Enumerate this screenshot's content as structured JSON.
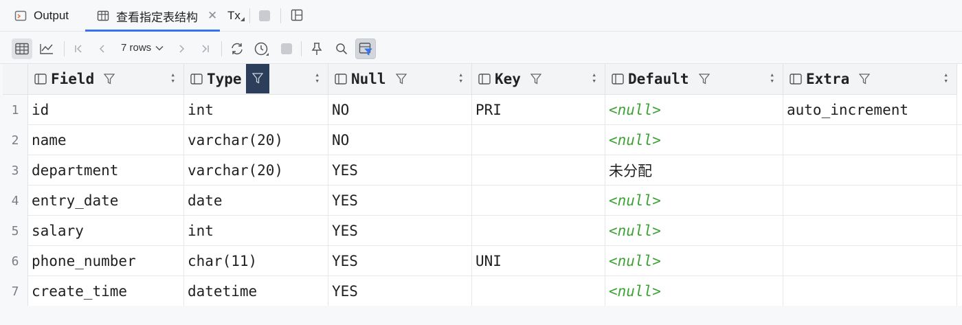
{
  "tabs": [
    {
      "label": "Output",
      "icon": "output-console-icon"
    },
    {
      "label": "查看指定表结构",
      "icon": "table-icon",
      "active": true
    },
    {
      "label": "Tx",
      "icon": "transaction-mode-icon"
    }
  ],
  "toolbar": {
    "rows_label": "7 rows"
  },
  "columns": [
    {
      "label": "Field"
    },
    {
      "label": "Type"
    },
    {
      "label": "Null"
    },
    {
      "label": "Key"
    },
    {
      "label": "Default"
    },
    {
      "label": "Extra"
    }
  ],
  "rows": [
    {
      "num": "1",
      "field": "id",
      "type": "int",
      "null": "NO",
      "key": "PRI",
      "default": "<null>",
      "extra": "auto_increment"
    },
    {
      "num": "2",
      "field": "name",
      "type": "varchar(20)",
      "null": "NO",
      "key": "",
      "default": "<null>",
      "extra": ""
    },
    {
      "num": "3",
      "field": "department",
      "type": "varchar(20)",
      "null": "YES",
      "key": "",
      "default": "未分配",
      "extra": ""
    },
    {
      "num": "4",
      "field": "entry_date",
      "type": "date",
      "null": "YES",
      "key": "",
      "default": "<null>",
      "extra": ""
    },
    {
      "num": "5",
      "field": "salary",
      "type": "int",
      "null": "YES",
      "key": "",
      "default": "<null>",
      "extra": ""
    },
    {
      "num": "6",
      "field": "phone_number",
      "type": "char(11)",
      "null": "YES",
      "key": "UNI",
      "default": "<null>",
      "extra": ""
    },
    {
      "num": "7",
      "field": "create_time",
      "type": "datetime",
      "null": "YES",
      "key": "",
      "default": "<null>",
      "extra": ""
    }
  ],
  "colors": {
    "null_value": "#3ca335",
    "accent": "#3574f0",
    "filter_highlight": "#2c3e5a"
  }
}
